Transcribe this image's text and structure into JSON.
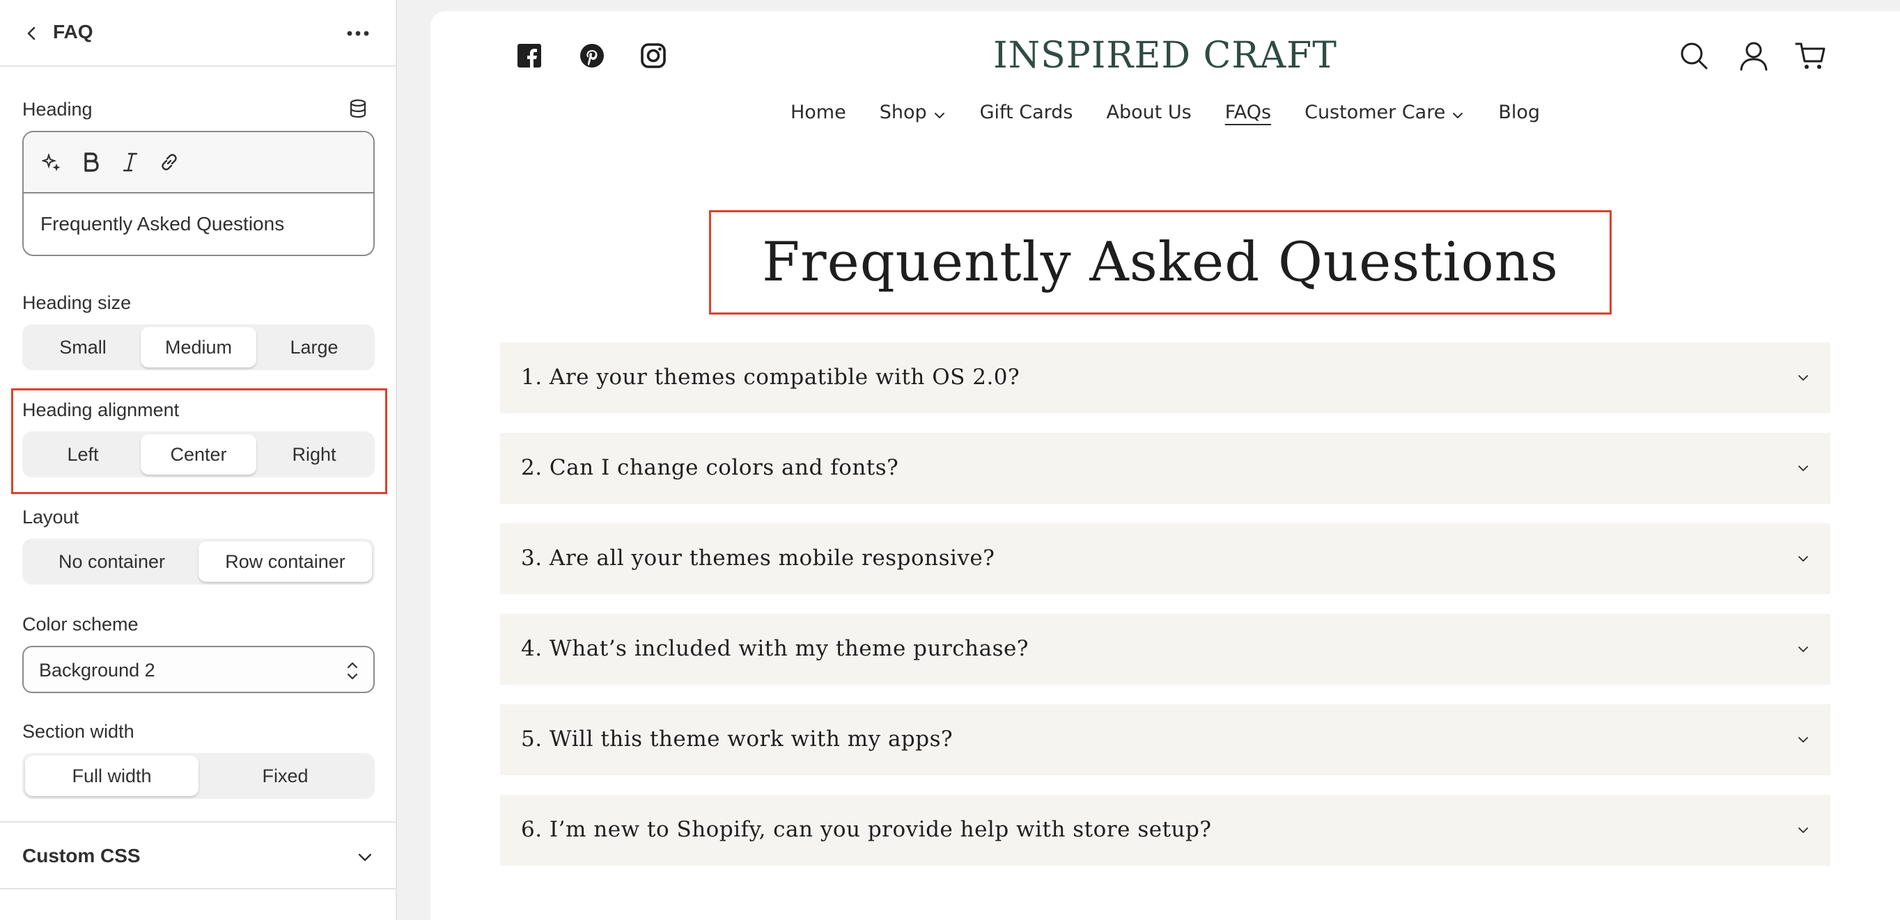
{
  "editor": {
    "title": "FAQ",
    "heading": {
      "label": "Heading",
      "value": "Frequently Asked Questions"
    },
    "heading_size": {
      "label": "Heading size",
      "options": [
        "Small",
        "Medium",
        "Large"
      ],
      "selected": "Medium"
    },
    "heading_alignment": {
      "label": "Heading alignment",
      "options": [
        "Left",
        "Center",
        "Right"
      ],
      "selected": "Center"
    },
    "layout": {
      "label": "Layout",
      "options": [
        "No container",
        "Row container"
      ],
      "selected": "Row container"
    },
    "color_scheme": {
      "label": "Color scheme",
      "value": "Background 2"
    },
    "section_width": {
      "label": "Section width",
      "options": [
        "Full width",
        "Fixed"
      ],
      "selected": "Full width"
    },
    "custom_css": {
      "label": "Custom CSS"
    }
  },
  "store": {
    "logo": "INSPIRED CRAFT",
    "nav": [
      {
        "label": "Home",
        "dropdown": false,
        "current": false
      },
      {
        "label": "Shop",
        "dropdown": true,
        "current": false
      },
      {
        "label": "Gift Cards",
        "dropdown": false,
        "current": false
      },
      {
        "label": "About Us",
        "dropdown": false,
        "current": false
      },
      {
        "label": "FAQs",
        "dropdown": false,
        "current": true
      },
      {
        "label": "Customer Care",
        "dropdown": true,
        "current": false
      },
      {
        "label": "Blog",
        "dropdown": false,
        "current": false
      }
    ],
    "social_icons": [
      "facebook-icon",
      "pinterest-icon",
      "instagram-icon"
    ],
    "header_icons": [
      "search-icon",
      "account-icon",
      "cart-icon"
    ],
    "page_title": "Frequently Asked Questions",
    "faqs": [
      "1. Are your themes compatible with OS 2.0?",
      "2. Can I change colors and fonts?",
      "3. Are all your themes mobile responsive?",
      "4. What’s included with my theme purchase?",
      "5. Will this theme work with my apps?",
      "6. I’m new to Shopify, can you provide help with store setup?"
    ]
  },
  "colors": {
    "highlight": "#e0402b",
    "logo": "#2f4b44",
    "faq_background": "#f5f4f0"
  }
}
